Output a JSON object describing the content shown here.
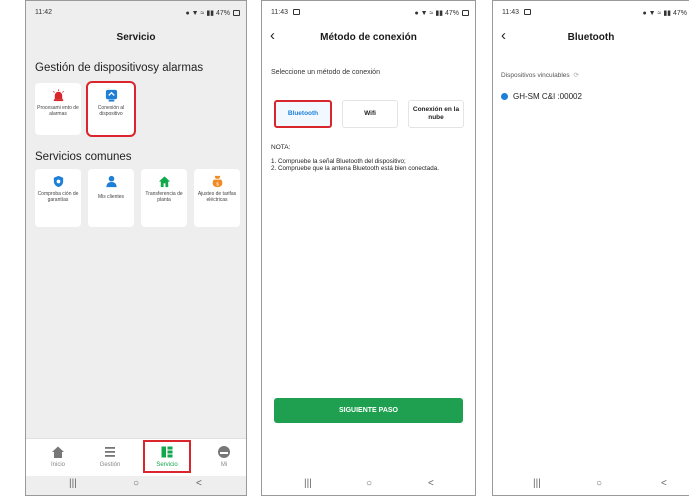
{
  "phone1": {
    "time": "11:42",
    "status_right": "47%",
    "title": "Servicio",
    "section1": "Gestión de dispositivosy alarmas",
    "section1_tiles": [
      {
        "label": "Procesami ento de alarmas",
        "icon": "alarm-icon",
        "color": "#d9262c"
      },
      {
        "label": "Conexión al dispositivo",
        "icon": "device-connection-icon",
        "color": "#1e7fd6"
      }
    ],
    "section2": "Servicios comunes",
    "section2_tiles": [
      {
        "label": "Comproba ción de garantías",
        "icon": "warranty-shield-icon",
        "color": "#1e7fd6"
      },
      {
        "label": "Mis clientes",
        "icon": "customers-icon",
        "color": "#1e7fd6"
      },
      {
        "label": "Transferencia de planta",
        "icon": "plant-transfer-icon",
        "color": "#11a74b"
      },
      {
        "label": "Ajustes de tarifas eléctricas",
        "icon": "tariff-icon",
        "color": "#f08a24"
      }
    ],
    "nav": [
      {
        "label": "Inicio",
        "icon": "home-icon"
      },
      {
        "label": "Gestión",
        "icon": "list-icon"
      },
      {
        "label": "Servicio",
        "icon": "service-icon"
      },
      {
        "label": "Mi",
        "icon": "profile-icon"
      }
    ],
    "sysnav": {
      "recents": "|||",
      "home": "○",
      "back": "<"
    }
  },
  "phone2": {
    "time": "11:43",
    "status_right": "47%",
    "title": "Método de conexión",
    "prompt": "Seleccione un método de conexión",
    "options": [
      "Bluetooth",
      "Wifi",
      "Conexión en la nube"
    ],
    "nota_title": "NOTA:",
    "nota_lines": [
      "1. Compruebe la señal Bluetooth del dispositivo;",
      "2. Compruebe que la antena Bluetooth está bien conectada."
    ],
    "next_button": "SIGUIENTE PASO",
    "sysnav": {
      "recents": "|||",
      "home": "○",
      "back": "<"
    }
  },
  "phone3": {
    "time": "11:43",
    "status_right": "47%",
    "title": "Bluetooth",
    "devices_header": "Dispositivos vinculables",
    "device": "GH-SM C&I :00002",
    "sysnav": {
      "recents": "|||",
      "home": "○",
      "back": "<"
    }
  },
  "colors": {
    "accent_green": "#11a74b",
    "highlight_red": "#d9262c",
    "blue": "#1e7fd6"
  }
}
